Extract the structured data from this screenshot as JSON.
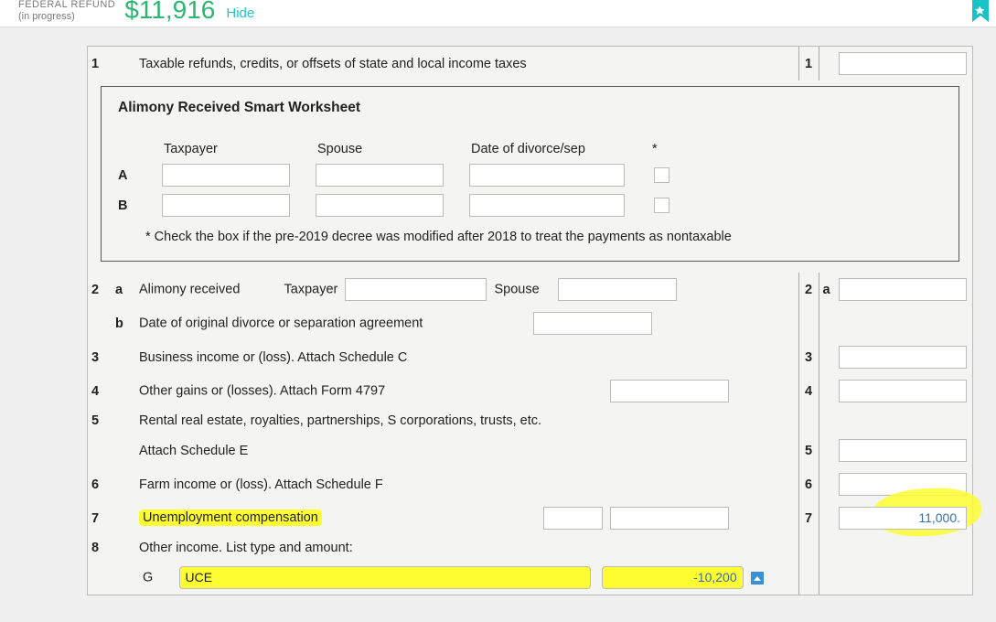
{
  "header": {
    "refund_label_line1": "FEDERAL REFUND",
    "refund_label_line2": "(in progress)",
    "refund_amount": "$11,916",
    "hide_label": "Hide"
  },
  "line1": {
    "num": "1",
    "desc": "Taxable refunds, credits, or offsets of state and local income taxes",
    "rnum": "1"
  },
  "alimony_ws": {
    "title": "Alimony Received Smart Worksheet",
    "hdr_taxpayer": "Taxpayer",
    "hdr_spouse": "Spouse",
    "hdr_date": "Date of divorce/sep",
    "hdr_star": "*",
    "rowA": "A",
    "rowB": "B",
    "note": "* Check the box if the pre-2019 decree was modified after 2018 to treat the payments as nontaxable"
  },
  "line2a": {
    "num": "2",
    "sub": "a",
    "desc": "Alimony received",
    "taxpayer_lbl": "Taxpayer",
    "spouse_lbl": "Spouse",
    "rnum": "2",
    "rsub": "a"
  },
  "line2b": {
    "sub": "b",
    "desc": "Date of original divorce or separation agreement"
  },
  "line3": {
    "num": "3",
    "desc": "Business income or (loss). Attach Schedule C",
    "rnum": "3"
  },
  "line4": {
    "num": "4",
    "desc": "Other gains or (losses). Attach Form 4797",
    "rnum": "4"
  },
  "line5": {
    "num": "5",
    "desc1": "Rental real estate, royalties, partnerships, S corporations, trusts, etc.",
    "desc2": "Attach Schedule E",
    "rnum": "5"
  },
  "line6": {
    "num": "6",
    "desc": "Farm income or (loss). Attach Schedule F",
    "rnum": "6"
  },
  "line7": {
    "num": "7",
    "desc": "Unemployment compensation",
    "rnum": "7",
    "value": "11,000."
  },
  "line8": {
    "num": "8",
    "desc": "Other income. List type and amount:",
    "g_label": "G",
    "g_type": "UCE",
    "g_amount": "-10,200"
  }
}
